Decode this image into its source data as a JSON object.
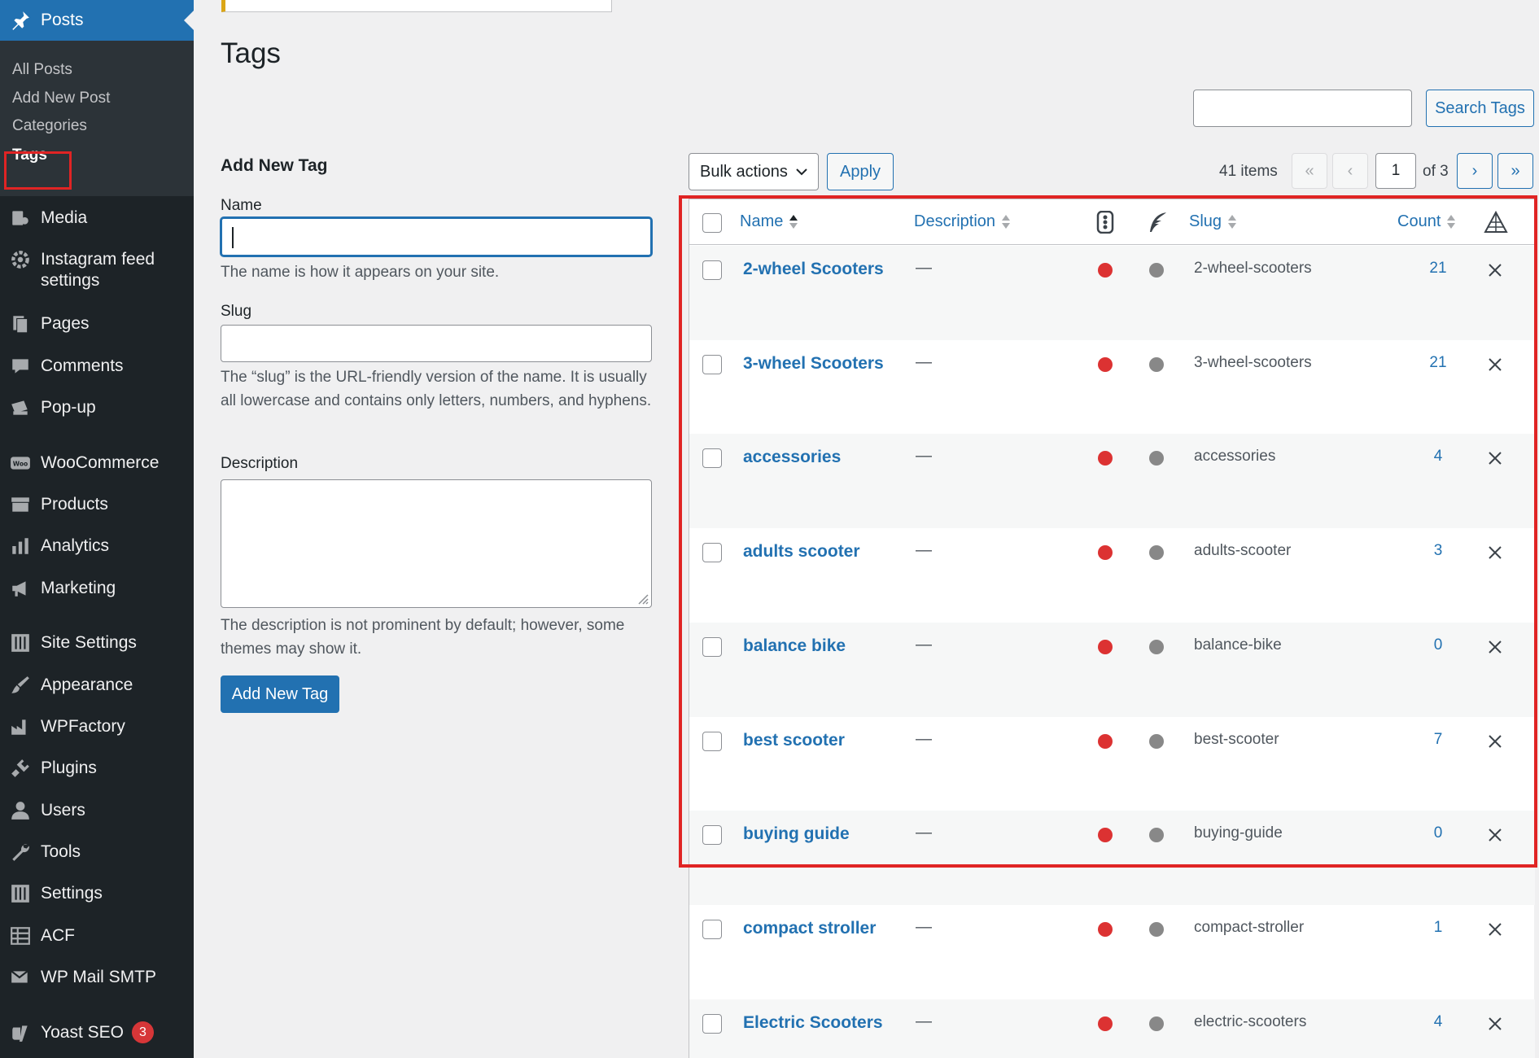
{
  "sidebar": {
    "posts_label": "Posts",
    "submenu": [
      "All Posts",
      "Add New Post",
      "Categories",
      "Tags"
    ],
    "items": [
      {
        "label": "Media",
        "icon": "media-icon"
      },
      {
        "label": "Instagram feed settings",
        "icon": "gear-icon"
      },
      {
        "label": "Pages",
        "icon": "pages-icon"
      },
      {
        "label": "Comments",
        "icon": "comment-icon"
      },
      {
        "label": "Pop-up",
        "icon": "popup-icon"
      },
      {
        "label": "WooCommerce",
        "icon": "woocommerce-icon"
      },
      {
        "label": "Products",
        "icon": "archive-icon"
      },
      {
        "label": "Analytics",
        "icon": "bar-chart-icon"
      },
      {
        "label": "Marketing",
        "icon": "megaphone-icon"
      },
      {
        "label": "Site Settings",
        "icon": "sliders-icon"
      },
      {
        "label": "Appearance",
        "icon": "paintbrush-icon"
      },
      {
        "label": "WPFactory",
        "icon": "factory-icon"
      },
      {
        "label": "Plugins",
        "icon": "plug-icon"
      },
      {
        "label": "Users",
        "icon": "user-icon"
      },
      {
        "label": "Tools",
        "icon": "wrench-icon"
      },
      {
        "label": "Settings",
        "icon": "sliders-icon"
      },
      {
        "label": "ACF",
        "icon": "table-icon"
      },
      {
        "label": "WP Mail SMTP",
        "icon": "mail-icon"
      },
      {
        "label": "Yoast SEO",
        "icon": "yoast-icon",
        "badge": "3"
      }
    ]
  },
  "page": {
    "title": "Tags",
    "search_button": "Search Tags",
    "search_value": ""
  },
  "form": {
    "heading": "Add New Tag",
    "name_label": "Name",
    "name_value": "",
    "name_help": "The name is how it appears on your site.",
    "slug_label": "Slug",
    "slug_value": "",
    "slug_help": "The “slug” is the URL-friendly version of the name. It is usually all lowercase and contains only letters, numbers, and hyphens.",
    "description_label": "Description",
    "description_value": "",
    "description_help": "The description is not prominent by default; however, some themes may show it.",
    "submit_label": "Add New Tag"
  },
  "tablenav": {
    "bulk_actions": "Bulk actions",
    "apply": "Apply",
    "items_count": "41 items",
    "first": "«",
    "prev": "‹",
    "current_page": "1",
    "of_pages": "of 3",
    "next": "›",
    "last": "»"
  },
  "table": {
    "columns": {
      "name": "Name",
      "description": "Description",
      "slug": "Slug",
      "count": "Count"
    },
    "rows": [
      {
        "name": "2-wheel Scooters",
        "description": "—",
        "slug": "2-wheel-scooters",
        "count": "21"
      },
      {
        "name": "3-wheel Scooters",
        "description": "—",
        "slug": "3-wheel-scooters",
        "count": "21"
      },
      {
        "name": "accessories",
        "description": "—",
        "slug": "accessories",
        "count": "4"
      },
      {
        "name": "adults scooter",
        "description": "—",
        "slug": "adults-scooter",
        "count": "3"
      },
      {
        "name": "balance bike",
        "description": "—",
        "slug": "balance-bike",
        "count": "0"
      },
      {
        "name": "best scooter",
        "description": "—",
        "slug": "best-scooter",
        "count": "7"
      },
      {
        "name": "buying guide",
        "description": "—",
        "slug": "buying-guide",
        "count": "0"
      },
      {
        "name": "compact stroller",
        "description": "—",
        "slug": "compact-stroller",
        "count": "1"
      },
      {
        "name": "Electric Scooters",
        "description": "—",
        "slug": "electric-scooters",
        "count": "4"
      }
    ]
  },
  "colors": {
    "accent": "#2271b1",
    "sidebar_bg": "#1d2327",
    "highlight": "#e02424",
    "seo_red": "#dc3232",
    "readability_grey": "#888888"
  }
}
